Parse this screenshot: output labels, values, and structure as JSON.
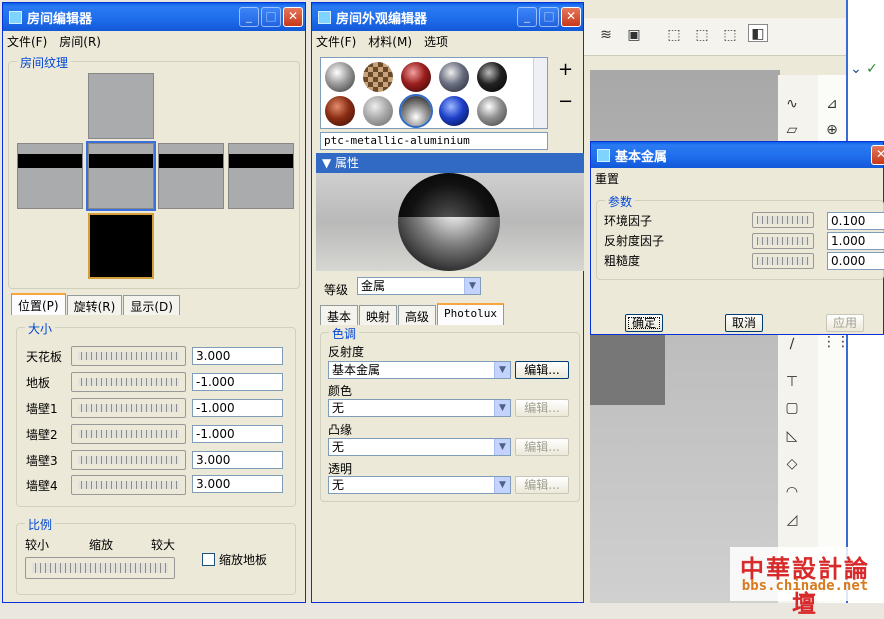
{
  "room_editor": {
    "title": "房间编辑器",
    "menu": [
      "文件(F)",
      "房间(R)"
    ],
    "texture_group": "房间纹理",
    "tabs": [
      "位置(P)",
      "旋转(R)",
      "显示(D)"
    ],
    "size_group": "大小",
    "rows": [
      {
        "label": "天花板",
        "value": "3.000"
      },
      {
        "label": "地板",
        "value": "-1.000"
      },
      {
        "label": "墙壁1",
        "value": "-1.000"
      },
      {
        "label": "墙壁2",
        "value": "-1.000"
      },
      {
        "label": "墙壁3",
        "value": "3.000"
      },
      {
        "label": "墙壁4",
        "value": "3.000"
      }
    ],
    "scale_group": "比例",
    "scale_labels": [
      "较小",
      "缩放",
      "较大"
    ],
    "scale_floor": "缩放地板"
  },
  "appearance_editor": {
    "title": "房间外观编辑器",
    "menu": [
      "文件(F)",
      "材料(M)",
      "选项"
    ],
    "plus": "+",
    "minus": "−",
    "material_name": "ptc-metallic-aluminium",
    "properties_header": "属性",
    "grade_label": "等级",
    "grade_value": "金属",
    "tabs": [
      "基本",
      "映射",
      "高级",
      "Photolux"
    ],
    "hue_group": "色调",
    "reflectance_label": "反射度",
    "reflectance_value": "基本金属",
    "color_label": "颜色",
    "color_value": "无",
    "bump_label": "凸缘",
    "bump_value": "无",
    "transparency_label": "透明",
    "transparency_value": "无",
    "edit_label": "编辑..."
  },
  "basic_metal": {
    "title": "基本金属",
    "menu": "重置",
    "params_group": "参数",
    "params": [
      {
        "label": "环境因子",
        "value": "0.100"
      },
      {
        "label": "反射度因子",
        "value": "1.000"
      },
      {
        "label": "粗糙度",
        "value": "0.000"
      }
    ],
    "ok": "确定",
    "cancel": "取消",
    "apply": "应用"
  },
  "watermark": {
    "line1": "中華設計論壇",
    "line2": "bbs.chinade.net"
  }
}
